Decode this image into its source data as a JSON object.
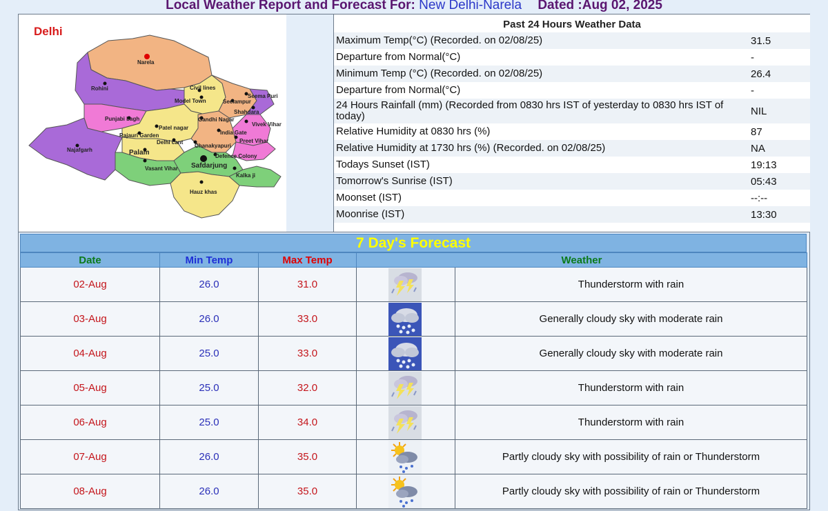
{
  "header": {
    "prefix": "Local Weather Report and Forecast For:",
    "location": "New Delhi-Narela",
    "dated": "Dated :Aug 02, 2025"
  },
  "map": {
    "region_label": "Delhi",
    "places": [
      "Narela",
      "Rohini",
      "Civil lines",
      "Seema Puri",
      "Model Town",
      "Seelampur",
      "Shahdara",
      "Punjabi bagh",
      "Gandhi Nagar",
      "Vivek Vihar",
      "Patel nagar",
      "India Gate",
      "Rajauri Garden",
      "Preet Vihar",
      "Najafgarh",
      "Delhi cant",
      "Chanakyapuri",
      "Palam",
      "Defence Colony",
      "Vasant Vihar",
      "Safdarjung",
      "Kalka ji",
      "Hauz khas"
    ]
  },
  "past24": {
    "title": "Past 24 Hours Weather Data",
    "rows": [
      {
        "label": "Maximum Temp(°C) (Recorded. on 02/08/25)",
        "value": "31.5"
      },
      {
        "label": "Departure from Normal(°C)",
        "value": "-"
      },
      {
        "label": "Minimum Temp (°C) (Recorded. on 02/08/25)",
        "value": "26.4"
      },
      {
        "label": "Departure from Normal(°C)",
        "value": "-"
      },
      {
        "label": "24 Hours Rainfall (mm) (Recorded from 0830 hrs IST of yesterday to 0830 hrs IST of today)",
        "value": "NIL"
      },
      {
        "label": "Relative Humidity at 0830 hrs (%)",
        "value": "87"
      },
      {
        "label": "Relative Humidity at 1730 hrs (%) (Recorded. on 02/08/25)",
        "value": "NA"
      },
      {
        "label": "Todays Sunset (IST)",
        "value": "19:13"
      },
      {
        "label": "Tomorrow's Sunrise (IST)",
        "value": "05:43"
      },
      {
        "label": "Moonset (IST)",
        "value": "--:--"
      },
      {
        "label": "Moonrise (IST)",
        "value": "13:30"
      }
    ]
  },
  "forecast": {
    "title": "7 Day's Forecast",
    "columns": {
      "date": "Date",
      "min": "Min Temp",
      "max": "Max Temp",
      "weather": "Weather"
    },
    "rows": [
      {
        "date": "02-Aug",
        "min": "26.0",
        "max": "31.0",
        "icon": "thunderstorm-icon",
        "weather": "Thunderstorm with rain"
      },
      {
        "date": "03-Aug",
        "min": "26.0",
        "max": "33.0",
        "icon": "cloud-rain-icon",
        "weather": "Generally cloudy sky with moderate rain"
      },
      {
        "date": "04-Aug",
        "min": "25.0",
        "max": "33.0",
        "icon": "cloud-rain-icon",
        "weather": "Generally cloudy sky with moderate rain"
      },
      {
        "date": "05-Aug",
        "min": "25.0",
        "max": "32.0",
        "icon": "thunderstorm-icon",
        "weather": "Thunderstorm with rain"
      },
      {
        "date": "06-Aug",
        "min": "25.0",
        "max": "34.0",
        "icon": "thunderstorm-icon",
        "weather": "Thunderstorm with rain"
      },
      {
        "date": "07-Aug",
        "min": "26.0",
        "max": "35.0",
        "icon": "sun-cloud-rain-icon",
        "weather": "Partly cloudy sky with possibility of rain or Thunderstorm"
      },
      {
        "date": "08-Aug",
        "min": "26.0",
        "max": "35.0",
        "icon": "sun-cloud-rain-icon",
        "weather": "Partly cloudy sky with possibility of rain or Thunderstorm"
      }
    ]
  }
}
